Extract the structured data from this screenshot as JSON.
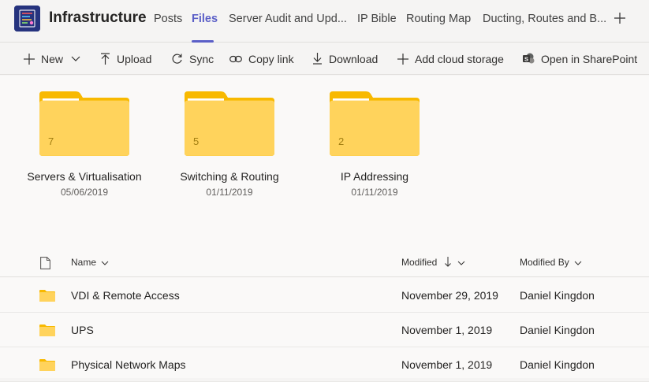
{
  "header": {
    "team_name": "Infrastructure",
    "tabs": [
      {
        "label": "Posts"
      },
      {
        "label": "Files"
      },
      {
        "label": "Server Audit and Upd..."
      },
      {
        "label": "IP Bible"
      },
      {
        "label": "Routing Map"
      },
      {
        "label": "Ducting, Routes and B..."
      }
    ],
    "active_tab": "Files",
    "add_tab_icon": "plus-icon"
  },
  "toolbar": {
    "new_label": "New",
    "upload_label": "Upload",
    "sync_label": "Sync",
    "copy_link_label": "Copy link",
    "download_label": "Download",
    "add_cloud_label": "Add cloud storage",
    "sharepoint_label": "Open in SharePoint"
  },
  "tiles": [
    {
      "name": "Servers & Virtualisation",
      "date": "05/06/2019",
      "count": "7"
    },
    {
      "name": "Switching & Routing",
      "date": "01/11/2019",
      "count": "5"
    },
    {
      "name": "IP Addressing",
      "date": "01/11/2019",
      "count": "2"
    }
  ],
  "list": {
    "col_name": "Name",
    "col_modified": "Modified",
    "col_modified_by": "Modified By",
    "rows": [
      {
        "name": "VDI & Remote Access",
        "modified": "November 29, 2019",
        "by": "Daniel Kingdon"
      },
      {
        "name": "UPS",
        "modified": "November 1, 2019",
        "by": "Daniel Kingdon"
      },
      {
        "name": "Physical Network Maps",
        "modified": "November 1, 2019",
        "by": "Daniel Kingdon"
      }
    ]
  },
  "colors": {
    "accent": "#5b5fc7",
    "folder": "#ffd35c",
    "folder_back": "#f8b900"
  }
}
